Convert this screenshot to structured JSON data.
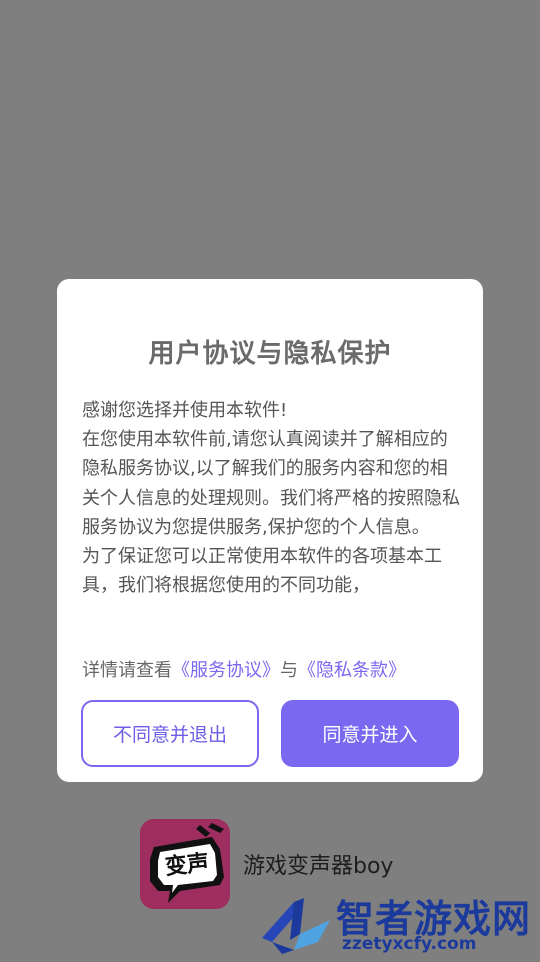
{
  "dialog": {
    "title": "用户协议与隐私保护",
    "paragraphs": [
      "感谢您选择并使用本软件!",
      "在您使用本软件前,请您认真阅读并了解相应的隐私服务协议,以了解我们的服务内容和您的相关个人信息的处理规则。我们将严格的按照隐私服务协议为您提供服务,保护您的个人信息。",
      "为了保证您可以正常使用本软件的各项基本工具，我们将根据您使用的不同功能，"
    ],
    "detail_prefix": "详情请查看",
    "service_link": "《服务协议》",
    "detail_joiner": "与",
    "privacy_link": "《隐私条款》",
    "decline_label": "不同意并退出",
    "accept_label": "同意并进入"
  },
  "app": {
    "name": "游戏变声器boy",
    "icon_text": "变声"
  },
  "watermark": {
    "text": "智者游戏网",
    "url": "zzetyxcfy.com"
  },
  "colors": {
    "overlay": "#7f7f7f",
    "accent": "#7b68f0",
    "app_icon_bg": "#9e2e60",
    "watermark": "#1c3a9c"
  }
}
